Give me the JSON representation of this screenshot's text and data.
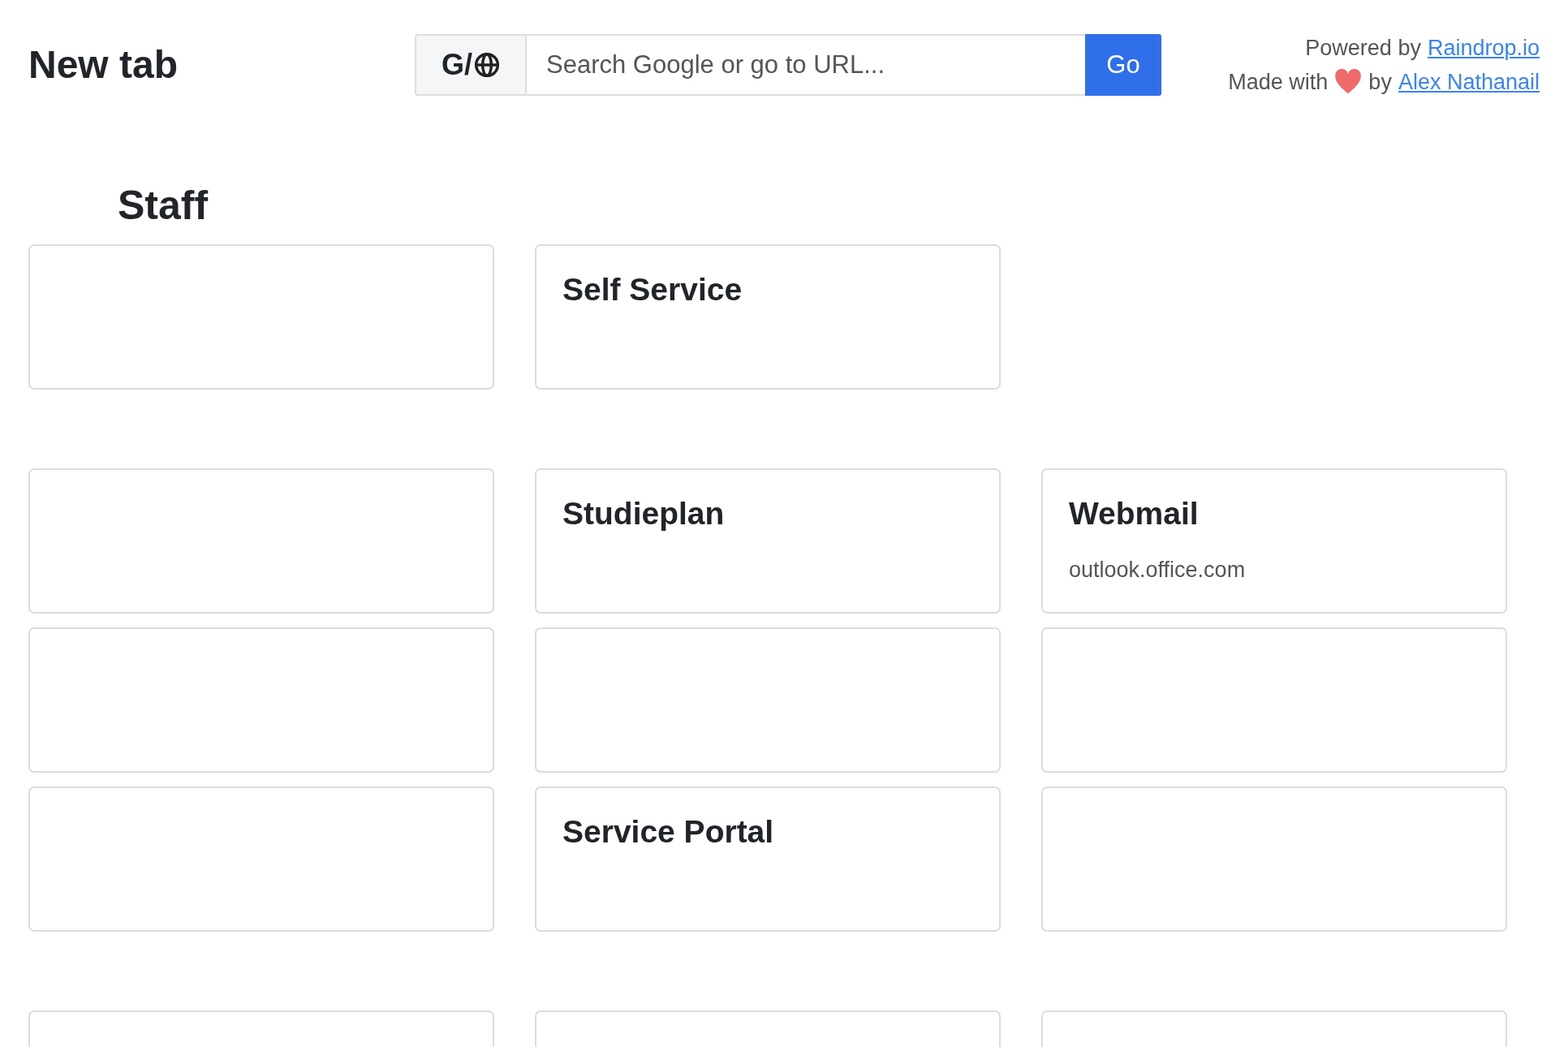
{
  "header": {
    "title": "New tab"
  },
  "search": {
    "prefix": "G/",
    "placeholder": "Search Google or go to URL...",
    "button": "Go"
  },
  "credits": {
    "powered_text": "Powered by",
    "powered_link": "Raindrop.io",
    "made_text": "Made with",
    "by_text": "by",
    "author_link": "Alex Nathanail"
  },
  "sections": [
    {
      "title": "Staff",
      "cards": [
        {
          "kind": "blank"
        },
        {
          "kind": "link",
          "title": "Self Service"
        }
      ]
    },
    {
      "cards": [
        {
          "kind": "blank"
        },
        {
          "kind": "link",
          "title": "Studieplan"
        },
        {
          "kind": "link",
          "title": "Webmail",
          "subtitle": "outlook.office.com"
        },
        {
          "kind": "blank"
        },
        {
          "kind": "blank"
        },
        {
          "kind": "blank"
        },
        {
          "kind": "blank"
        },
        {
          "kind": "link",
          "title": "Service Portal"
        },
        {
          "kind": "blank"
        }
      ]
    },
    {
      "cards": [
        {
          "kind": "blank"
        },
        {
          "kind": "blank"
        },
        {
          "kind": "blank"
        }
      ]
    }
  ]
}
